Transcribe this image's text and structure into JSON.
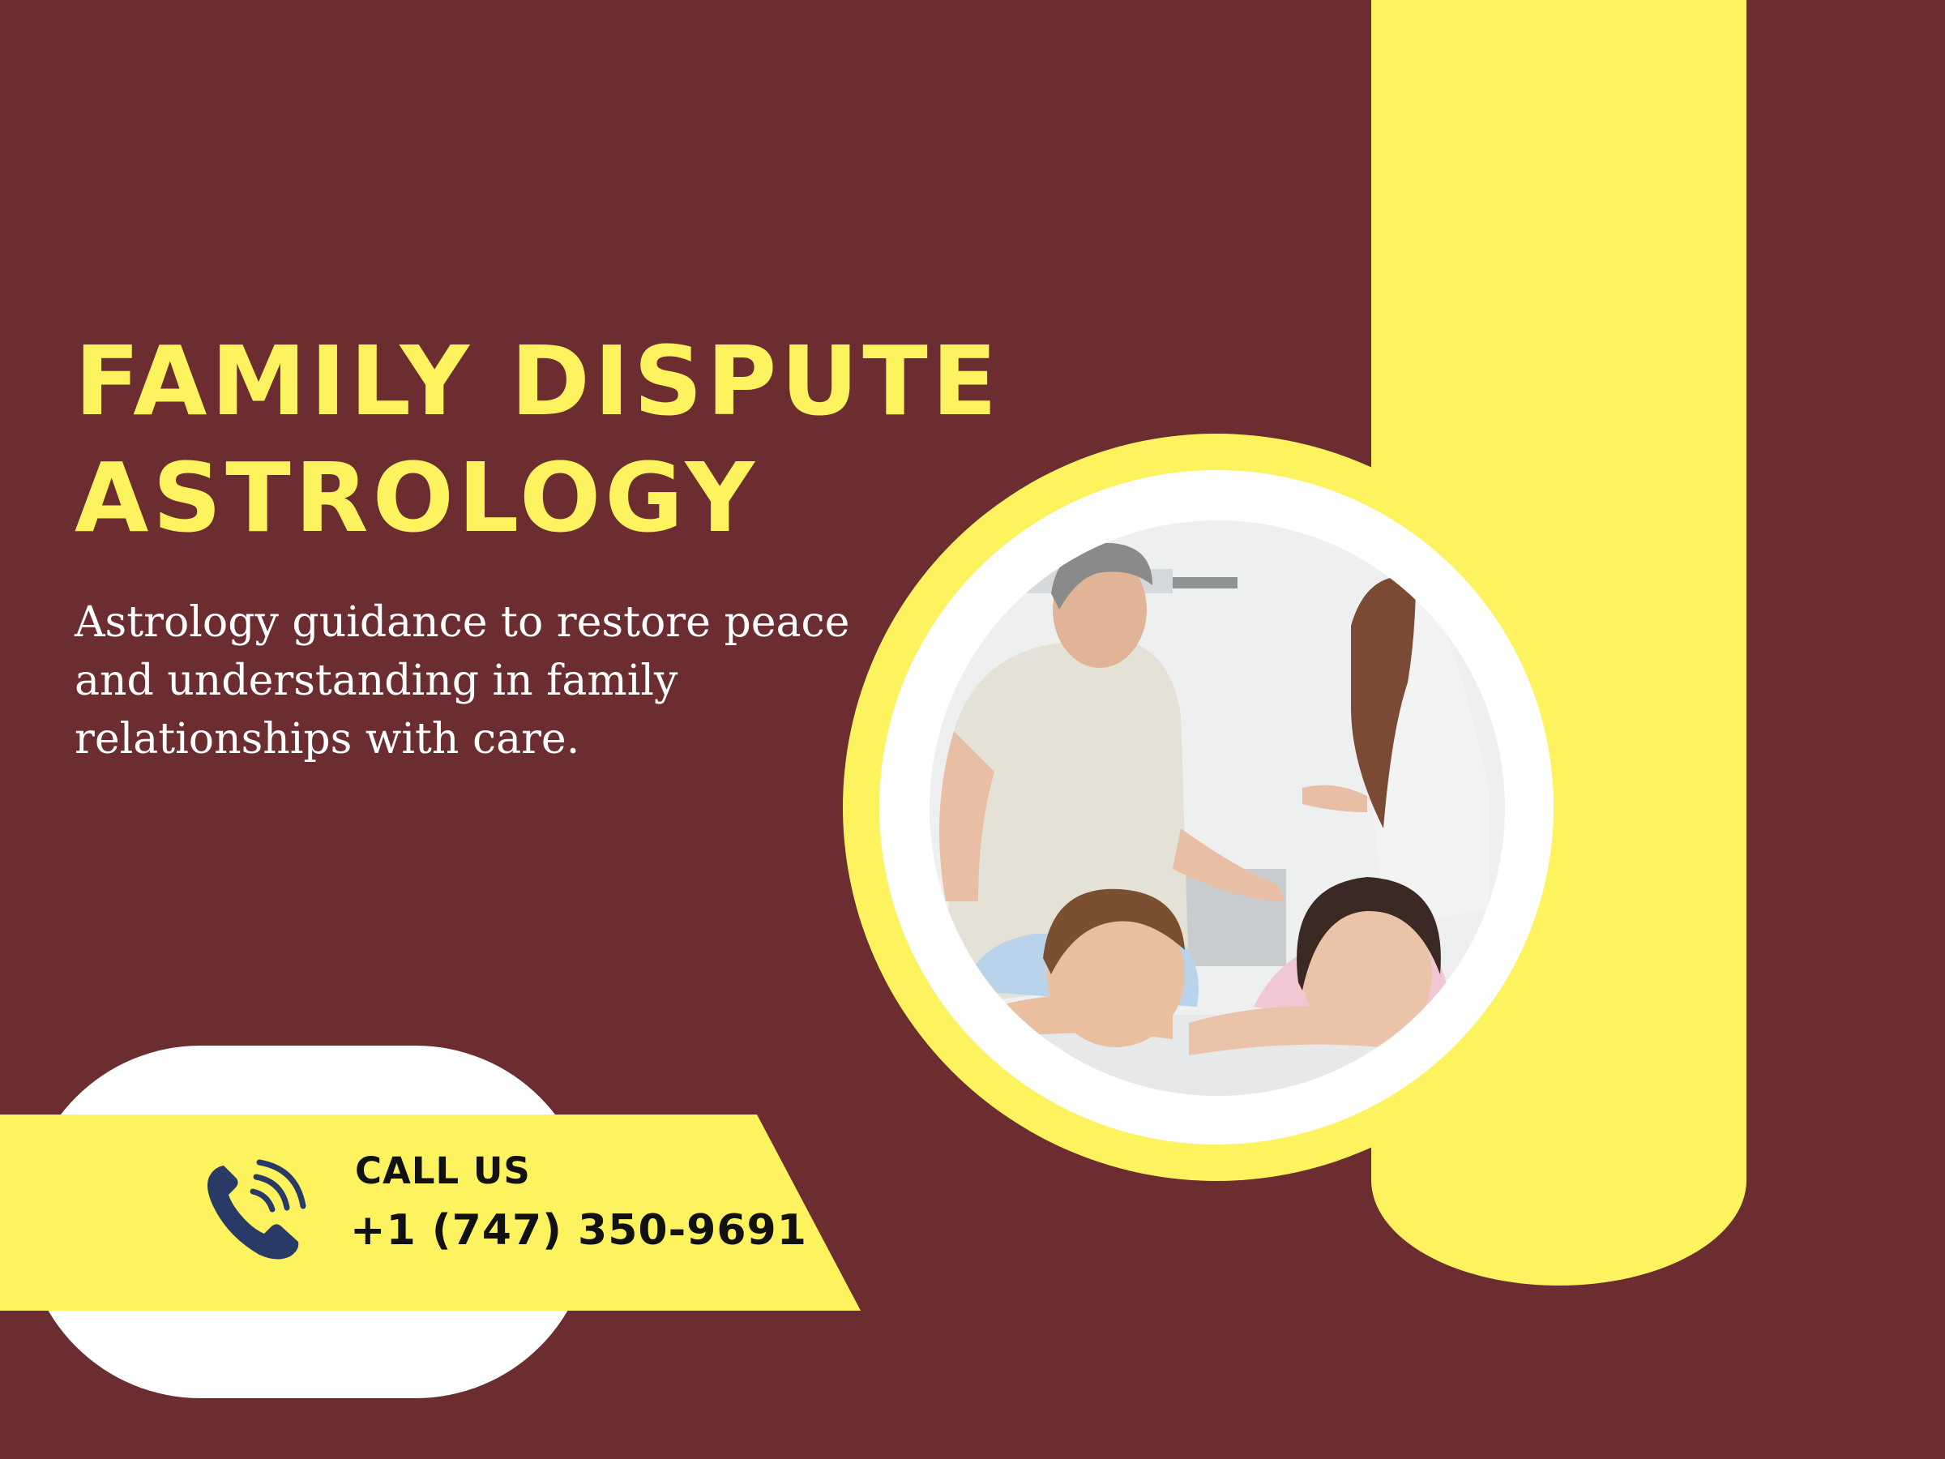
{
  "headline": {
    "line1": "FAMILY DISPUTE",
    "line2": "ASTROLOGY"
  },
  "subtitle": {
    "line1": "Astrology guidance to restore peace",
    "line2": "and understanding in family",
    "line3": "relationships with care."
  },
  "call": {
    "label": "CALL US",
    "phone": "+1 (747) 350-9691",
    "icon": "phone-icon"
  },
  "photo": {
    "subject": "arguing parents with sad children"
  },
  "colors": {
    "background": "#6b2d2f",
    "accent": "#fdf35f",
    "white": "#ffffff",
    "icon": "#2a3a66",
    "text_dark": "#111111"
  }
}
